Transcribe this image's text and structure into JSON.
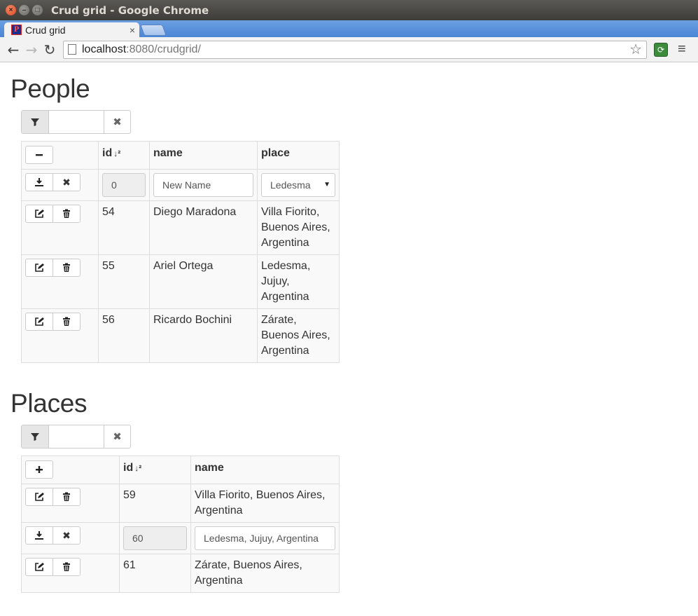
{
  "window": {
    "title": "Crud grid - Google Chrome",
    "tab_title": "Crud grid",
    "url_host": "localhost",
    "url_path": ":8080/crudgrid/"
  },
  "people": {
    "title": "People",
    "filter_value": "",
    "columns": [
      "id",
      "name",
      "place"
    ],
    "new_row": {
      "id": "0",
      "name_placeholder": "New Name",
      "place_selected": "Ledesma"
    },
    "rows": [
      {
        "id": "54",
        "name": "Diego Maradona",
        "place": [
          "Villa Fiorito,",
          "Buenos Aires,",
          "Argentina"
        ]
      },
      {
        "id": "55",
        "name": "Ariel Ortega",
        "place": [
          "Ledesma,",
          "Jujuy,",
          "Argentina"
        ]
      },
      {
        "id": "56",
        "name": "Ricardo Bochini",
        "place": [
          "Zárate,",
          "Buenos Aires,",
          "Argentina"
        ]
      }
    ]
  },
  "places": {
    "title": "Places",
    "filter_value": "",
    "columns": [
      "id",
      "name"
    ],
    "rows": [
      {
        "id": "59",
        "name": [
          "Villa Fiorito, Buenos Aires,",
          "Argentina"
        ]
      },
      {
        "id": "60",
        "name_value": "Ledesma, Jujuy, Argentina",
        "editing": true
      },
      {
        "id": "61",
        "name": [
          "Zárate, Buenos Aires,",
          "Argentina"
        ]
      }
    ]
  },
  "icons": {
    "filter": "filter-icon",
    "clear": "clear-icon",
    "collapse": "minus-icon",
    "add": "plus-icon",
    "save": "save-icon",
    "cancel": "cancel-icon",
    "edit": "edit-icon",
    "delete": "trash-icon",
    "sort": "sort-numeric-asc-icon"
  }
}
